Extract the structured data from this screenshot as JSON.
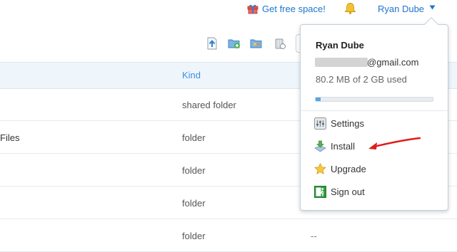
{
  "topbar": {
    "free_space_label": "Get free space!",
    "user_name": "Ryan Dube",
    "icons": [
      "gift-icon",
      "bell-icon",
      "chevron-down-icon"
    ]
  },
  "toolbar": {
    "icons": [
      "upload-icon",
      "new-folder-icon",
      "share-folder-icon",
      "deleted-files-icon"
    ]
  },
  "table": {
    "kind_header": "Kind",
    "rows": [
      {
        "name": "",
        "kind": "shared folder",
        "modified": ""
      },
      {
        "name": "Files",
        "kind": "folder",
        "modified": ""
      },
      {
        "name": "",
        "kind": "folder",
        "modified": ""
      },
      {
        "name": "",
        "kind": "folder",
        "modified": ""
      },
      {
        "name": "",
        "kind": "folder",
        "modified": "--"
      }
    ]
  },
  "account_menu": {
    "name": "Ryan Dube",
    "email_visible": "@gmail.com",
    "usage_text": "80.2 MB of 2 GB used",
    "quota_fraction": 0.04,
    "items": [
      {
        "label": "Settings",
        "icon": "settings-icon"
      },
      {
        "label": "Install",
        "icon": "install-icon"
      },
      {
        "label": "Upgrade",
        "icon": "star-icon"
      },
      {
        "label": "Sign out",
        "icon": "sign-out-icon"
      }
    ]
  },
  "colors": {
    "link_blue": "#1f75cc",
    "header_bg": "#eef6fc",
    "annotation_red": "#e11b1b"
  }
}
